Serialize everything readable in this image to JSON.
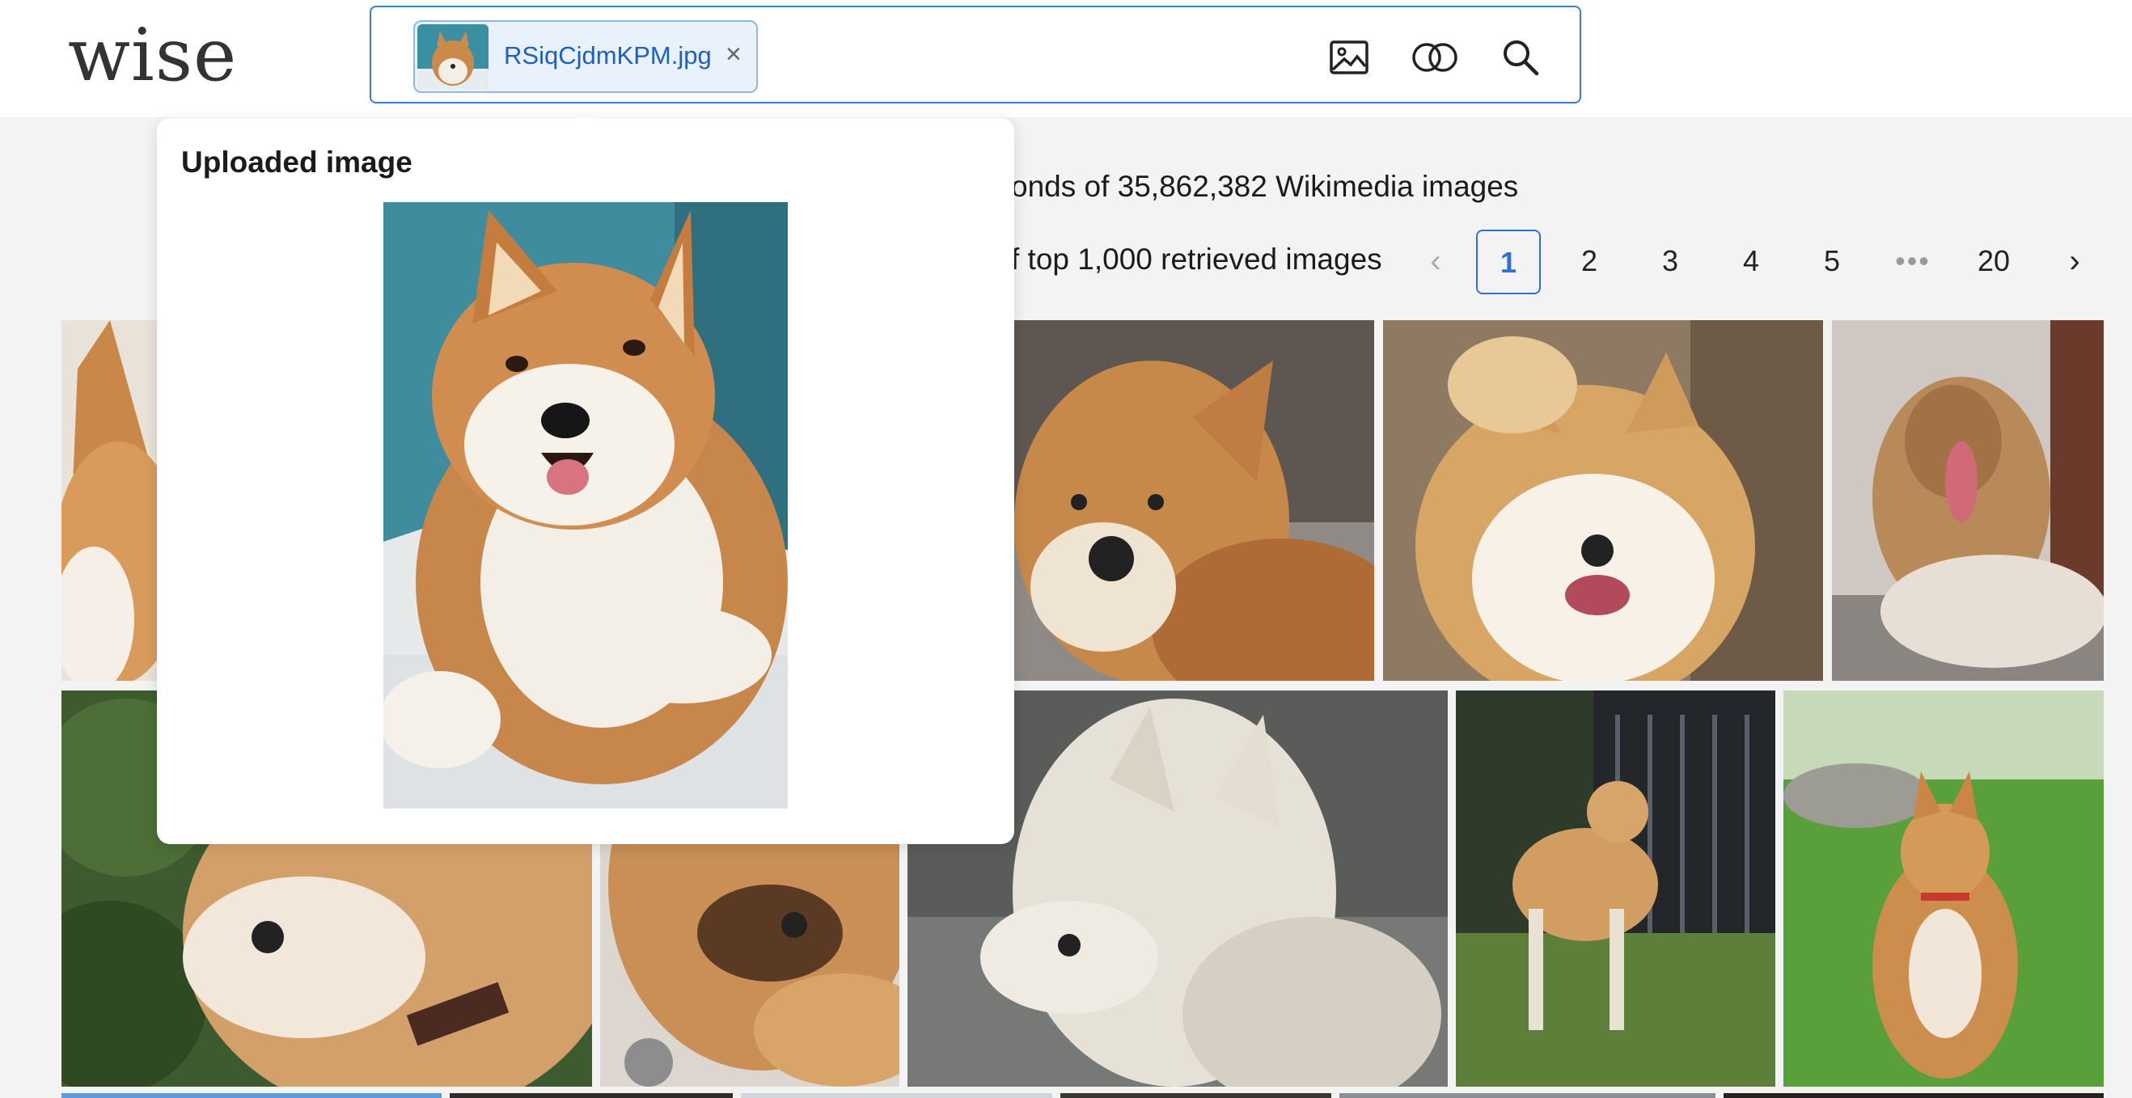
{
  "header": {
    "logo_text": "wise",
    "uploaded_file_name": "RSiqCjdmKPM.jpg",
    "chip_close_glyph": "×",
    "icons": [
      "image-search-icon",
      "combine-icon",
      "search-icon"
    ]
  },
  "results": {
    "summary_text": "onds of 35,862,382 Wikimedia images",
    "page_info_text": "f top 1,000 retrieved images"
  },
  "pagination": {
    "prev": "‹",
    "pages": [
      "1",
      "2",
      "3",
      "4",
      "5"
    ],
    "ellipsis": "•••",
    "last": "20",
    "next": "›",
    "current": "1"
  },
  "popover": {
    "title": "Uploaded image"
  },
  "colors": {
    "accent": "#2f6fd1",
    "chip_bg": "#e8f1fc",
    "page_bg": "#f3f3f3"
  }
}
